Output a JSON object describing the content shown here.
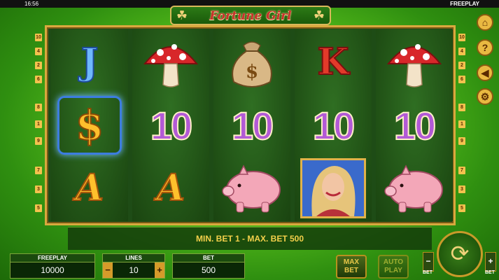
{
  "topbar": {
    "time": "16:56",
    "mode": "FREEPLAY"
  },
  "logo": {
    "title": "Fortune Girl"
  },
  "reels": [
    [
      "J",
      "$",
      "A"
    ],
    [
      "mushroom",
      "10",
      "A"
    ],
    [
      "money-bag",
      "10",
      "pig"
    ],
    [
      "K",
      "10",
      "girl"
    ],
    [
      "mushroom",
      "10",
      "pig"
    ]
  ],
  "paylines": {
    "left": [
      "10",
      "4",
      "2",
      "6",
      "8",
      "1",
      "9",
      "7",
      "3",
      "5"
    ],
    "right": [
      "10",
      "4",
      "2",
      "6",
      "8",
      "1",
      "9",
      "7",
      "3",
      "5"
    ]
  },
  "side_buttons": {
    "home": "⌂",
    "help": "?",
    "sound": "◀",
    "settings": "⚙"
  },
  "message": "MIN. BET 1 - MAX. BET 500",
  "panels": {
    "freeplay": {
      "label": "FREEPLAY",
      "value": "10000"
    },
    "lines": {
      "label": "LINES",
      "value": "10",
      "minus": "−",
      "plus": "+"
    },
    "bet": {
      "label": "BET",
      "value": "500"
    }
  },
  "buttons": {
    "maxbet_1": "MAX",
    "maxbet_2": "BET",
    "autoplay_1": "AUTO",
    "autoplay_2": "PLAY",
    "spin": "⟳",
    "bet_minus": "−",
    "bet_plus": "+",
    "bet_minus_label": "BET",
    "bet_plus_label": "BET"
  },
  "colors": {
    "accent": "#e9c648",
    "frame": "#d9a93e",
    "background": "#5fc81e"
  }
}
